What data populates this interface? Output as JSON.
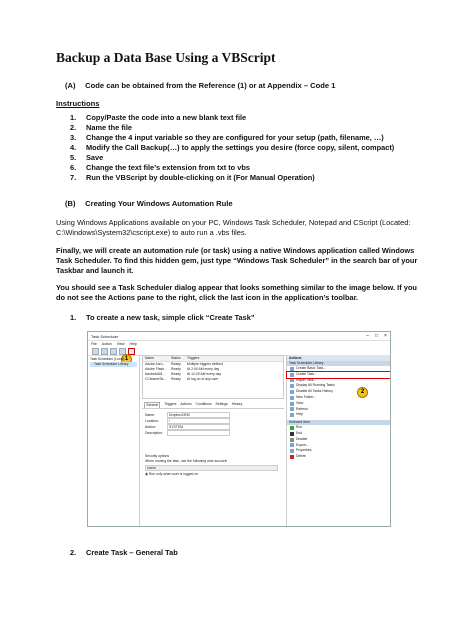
{
  "title": "Backup a Data Base Using a VBScript",
  "section_a": {
    "label": "(A)",
    "text": "Code can be obtained from the Reference (1) or at Appendix – Code 1"
  },
  "instructions_heading": "Instructions",
  "steps": [
    {
      "num": "1.",
      "text": "Copy/Paste the code into a new blank text file"
    },
    {
      "num": "2.",
      "text": "Name the file"
    },
    {
      "num": "3.",
      "text": "Change the 4 input variable so they are configured for your setup (path, filename, …)"
    },
    {
      "num": "4.",
      "text": "Modify the Call Backup(…) to apply the settings you desire (force copy, silent, compact)"
    },
    {
      "num": "5.",
      "text": "Save"
    },
    {
      "num": "6.",
      "text": "Change the text file’s extension from txt to vbs"
    },
    {
      "num": "7.",
      "text": "Run the VBScript by double-clicking on it (For Manual Operation)"
    }
  ],
  "section_b": {
    "label": "(B)",
    "text": "Creating Your Windows Automation Rule"
  },
  "para1": "Using Windows Applications available on your PC, Windows Task Scheduler, Notepad and CScript (Located: C:\\Windows\\System32\\cscript.exe) to auto run a .vbs files.",
  "para2": "Finally, we will create an automation rule (or task) using a native Windows application called Windows Task Scheduler. To find this hidden gem, just type “Windows Task Scheduler” in the search bar of your Taskbar and launch it.",
  "para3": "You should see a Task Scheduler dialog appear that looks something similar to the image below. If you do not see the Actions pane to the right, click the last icon in the application’s toolbar.",
  "item1": {
    "num": "1.",
    "text": "To create a new task, simple click “Create Task”"
  },
  "item2": {
    "num": "2.",
    "text": "Create Task – General Tab"
  },
  "shot": {
    "window_title": "Task Scheduler",
    "menu": [
      "File",
      "Action",
      "View",
      "Help"
    ],
    "badge1": "1",
    "badge2": "2",
    "tree": [
      "Task Scheduler (Local)",
      "Task Scheduler Library"
    ],
    "grid_headers": [
      "Name",
      "Status",
      "Triggers"
    ],
    "grid_rows": [
      [
        "Adobe Acro...",
        "Ready",
        "Multiple triggers defined"
      ],
      [
        "Adobe Flash...",
        "Ready",
        "At 2:00 AM every day"
      ],
      [
        "AdobeAAM...",
        "Ready",
        "At 12:29 AM every day"
      ],
      [
        "CCleanerSk...",
        "Ready",
        "At log on of any user"
      ]
    ],
    "tabs": [
      "General",
      "Triggers",
      "Actions",
      "Conditions",
      "Settings",
      "History"
    ],
    "form": [
      {
        "k": "Name:",
        "v": "DropboxOEM"
      },
      {
        "k": "Location:",
        "v": "\\"
      },
      {
        "k": "Author:",
        "v": "SYSTEM"
      },
      {
        "k": "Description:",
        "v": ""
      }
    ],
    "security_label": "Security options",
    "security_text": "When running the task, use the following user account:",
    "security_user": "Users",
    "run_only": "Run only when user is logged on",
    "actions_header": "Actions",
    "library_header": "Task Scheduler Library",
    "library_actions": [
      "Create Basic Task...",
      "Create Task...",
      "Import Task...",
      "Display All Running Tasks",
      "Disable All Tasks History",
      "New Folder...",
      "View",
      "Refresh",
      "Help"
    ],
    "selected_header": "Selected Item",
    "selected_actions": [
      "Run",
      "End",
      "Disable",
      "Export...",
      "Properties",
      "Delete"
    ]
  }
}
